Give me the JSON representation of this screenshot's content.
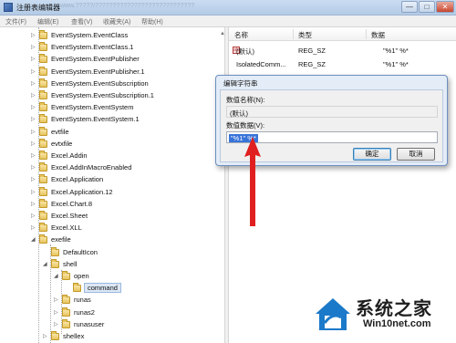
{
  "window": {
    "title": "注册表编辑器",
    "blurred_path": "www.?????/????????????????????????????",
    "controls": [
      "—",
      "□",
      "✕"
    ]
  },
  "menu": [
    "文件(F)",
    "编辑(E)",
    "查看(V)",
    "收藏夹(A)",
    "帮助(H)"
  ],
  "tree": {
    "items": [
      {
        "label": "EventSystem.EventClass",
        "level": 0,
        "expander": "▷"
      },
      {
        "label": "EventSystem.EventClass.1",
        "level": 0,
        "expander": "▷"
      },
      {
        "label": "EventSystem.EventPublisher",
        "level": 0,
        "expander": "▷"
      },
      {
        "label": "EventSystem.EventPublisher.1",
        "level": 0,
        "expander": "▷"
      },
      {
        "label": "EventSystem.EventSubscription",
        "level": 0,
        "expander": "▷"
      },
      {
        "label": "EventSystem.EventSubscription.1",
        "level": 0,
        "expander": "▷"
      },
      {
        "label": "EventSystem.EventSystem",
        "level": 0,
        "expander": "▷"
      },
      {
        "label": "EventSystem.EventSystem.1",
        "level": 0,
        "expander": "▷"
      },
      {
        "label": "evtfile",
        "level": 0,
        "expander": "▷"
      },
      {
        "label": "evtxfile",
        "level": 0,
        "expander": "▷"
      },
      {
        "label": "Excel.Addin",
        "level": 0,
        "expander": "▷"
      },
      {
        "label": "Excel.AddInMacroEnabled",
        "level": 0,
        "expander": "▷"
      },
      {
        "label": "Excel.Application",
        "level": 0,
        "expander": "▷"
      },
      {
        "label": "Excel.Application.12",
        "level": 0,
        "expander": "▷"
      },
      {
        "label": "Excel.Chart.8",
        "level": 0,
        "expander": "▷"
      },
      {
        "label": "Excel.Sheet",
        "level": 0,
        "expander": "▷"
      },
      {
        "label": "Excel.XLL",
        "level": 0,
        "expander": "▷"
      },
      {
        "label": "exefile",
        "level": 0,
        "expander": "◢"
      },
      {
        "label": "DefaultIcon",
        "level": 1,
        "expander": ""
      },
      {
        "label": "shell",
        "level": 1,
        "expander": "◢"
      },
      {
        "label": "open",
        "level": 2,
        "expander": "◢"
      },
      {
        "label": "command",
        "level": 3,
        "expander": "",
        "selected": true
      },
      {
        "label": "runas",
        "level": 2,
        "expander": "▷"
      },
      {
        "label": "runas2",
        "level": 2,
        "expander": "▷"
      },
      {
        "label": "runasuser",
        "level": 2,
        "expander": "▷"
      },
      {
        "label": "shellex",
        "level": 1,
        "expander": "▷"
      }
    ]
  },
  "values": {
    "headers": {
      "name": "名称",
      "type": "类型",
      "data": "数据"
    },
    "rows": [
      {
        "name": "(默认)",
        "type": "REG_SZ",
        "data": "\"%1\" %*"
      },
      {
        "name": "IsolatedComm...",
        "type": "REG_SZ",
        "data": "\"%1\" %*"
      }
    ]
  },
  "dialog": {
    "title": "编辑字符串",
    "name_label": "数值名称(N):",
    "name_value": "(默认)",
    "data_label": "数值数据(V):",
    "data_value": "\"%1\" %*",
    "ok_label": "确定",
    "cancel_label": "取消"
  },
  "watermark": {
    "line1": "系统之家",
    "line2": "Win10net.com"
  },
  "colors": {
    "arrow": "#e02020",
    "selection": "#3874d8",
    "folder": "#e7c55e"
  }
}
